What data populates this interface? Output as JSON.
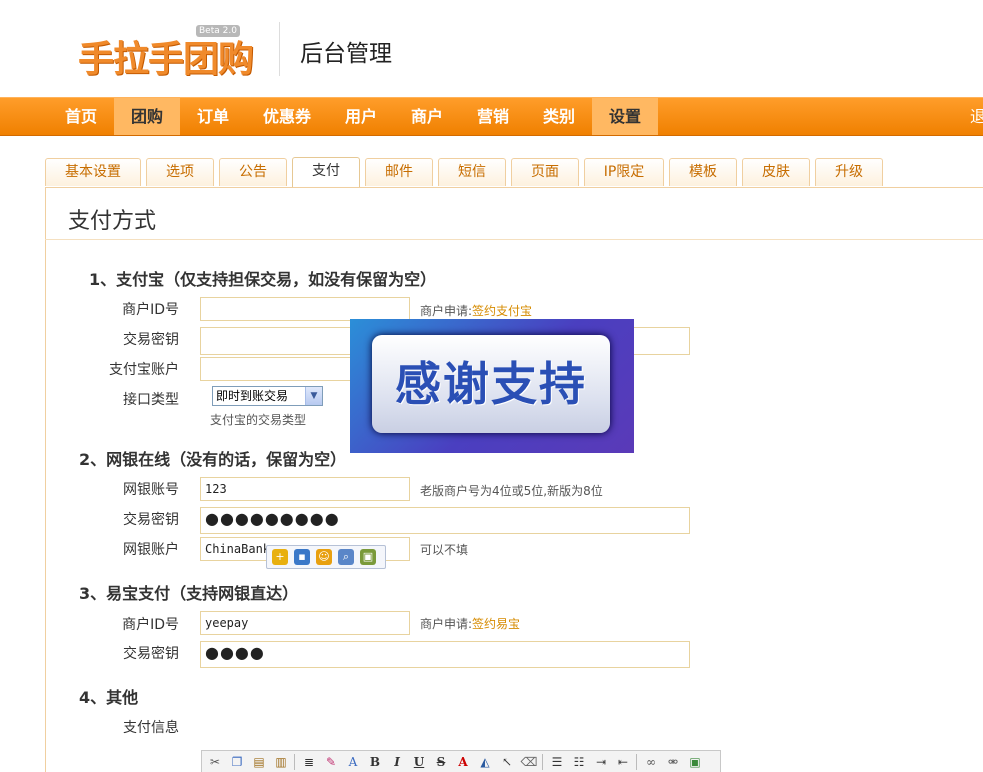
{
  "header": {
    "logo_text": "手拉手团购",
    "beta_badge": "Beta 2.0",
    "admin_title": "后台管理"
  },
  "nav": {
    "items": [
      "首页",
      "团购",
      "订单",
      "优惠券",
      "用户",
      "商户",
      "营销",
      "类别",
      "设置"
    ],
    "exit_label": "退"
  },
  "tabs": [
    "基本设置",
    "选项",
    "公告",
    "支付",
    "邮件",
    "短信",
    "页面",
    "IP限定",
    "模板",
    "皮肤",
    "升级"
  ],
  "active_tab": "支付",
  "page_title": "支付方式",
  "alipay": {
    "title": "1、支付宝（仅支持担保交易，如没有保留为空）",
    "merchant_id_label": "商户ID号",
    "merchant_id_value": "",
    "apply_prefix": "商户申请:",
    "apply_link": "签约支付宝",
    "secret_label": "交易密钥",
    "secret_value": "",
    "account_label": "支付宝账户",
    "account_value": "",
    "interface_label": "接口类型",
    "interface_selected": "即时到账交易",
    "interface_hint": "支付宝的交易类型"
  },
  "chinabank": {
    "title": "2、网银在线（没有的话，保留为空）",
    "account_no_label": "网银账号",
    "account_no_value": "123",
    "account_no_hint": "老版商户号为4位或5位,新版为8位",
    "secret_label": "交易密钥",
    "secret_value": "●●●●●●●●●",
    "user_label": "网银账户",
    "user_value": "ChinaBank",
    "user_hint": "可以不填"
  },
  "yeepay": {
    "title": "3、易宝支付（支持网银直达）",
    "merchant_id_label": "商户ID号",
    "merchant_id_value": "yeepay",
    "apply_prefix": "商户申请:",
    "apply_link": "签约易宝",
    "secret_label": "交易密钥",
    "secret_value": "●●●●"
  },
  "other": {
    "title": "4、其他",
    "payinfo_label": "支付信息"
  },
  "overlay": {
    "text": "感谢支持"
  },
  "colors": {
    "nav_orange": "#f08000",
    "link_orange": "#d68b00",
    "tab_text": "#c76d00"
  }
}
